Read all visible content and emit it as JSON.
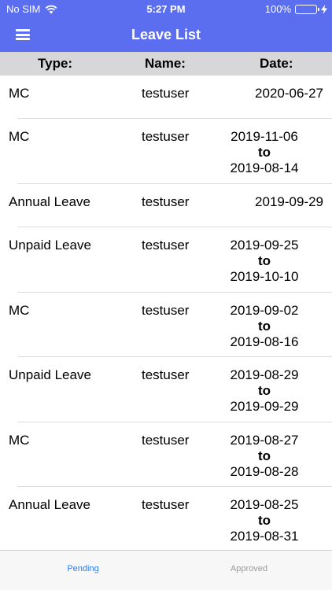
{
  "status_bar": {
    "carrier": "No SIM",
    "time": "5:27 PM",
    "battery": "100%",
    "battery_level": 1.0,
    "battery_color": "#2dd14a",
    "wifi_icon": "wifi-icon",
    "bolt_icon": "charging-bolt-icon"
  },
  "nav": {
    "title": "Leave List",
    "menu_icon": "hamburger-menu-icon",
    "bar_color": "#5b6ef0"
  },
  "table": {
    "headers": {
      "type": "Type:",
      "name": "Name:",
      "date": "Date:"
    },
    "rows": [
      {
        "type": "MC",
        "name": "testuser",
        "start": "2020-06-27",
        "to": "",
        "end": ""
      },
      {
        "type": "MC",
        "name": "testuser",
        "start": "2019-11-06",
        "to": "to",
        "end": "2019-08-14"
      },
      {
        "type": "Annual Leave",
        "name": "testuser",
        "start": "2019-09-29",
        "to": "",
        "end": ""
      },
      {
        "type": "Unpaid Leave",
        "name": "testuser",
        "start": "2019-09-25",
        "to": "to",
        "end": "2019-10-10"
      },
      {
        "type": "MC",
        "name": "testuser",
        "start": "2019-09-02",
        "to": "to",
        "end": "2019-08-16"
      },
      {
        "type": "Unpaid Leave",
        "name": "testuser",
        "start": "2019-08-29",
        "to": "to",
        "end": "2019-09-29"
      },
      {
        "type": "MC",
        "name": "testuser",
        "start": "2019-08-27",
        "to": "to",
        "end": "2019-08-28"
      },
      {
        "type": "Annual Leave",
        "name": "testuser",
        "start": "2019-08-25",
        "to": "to",
        "end": "2019-08-31"
      }
    ]
  },
  "tabs": {
    "pending": "Pending",
    "approved": "Approved",
    "active": "pending",
    "active_color": "#2f7df6",
    "inactive_color": "#9b9b9b"
  }
}
